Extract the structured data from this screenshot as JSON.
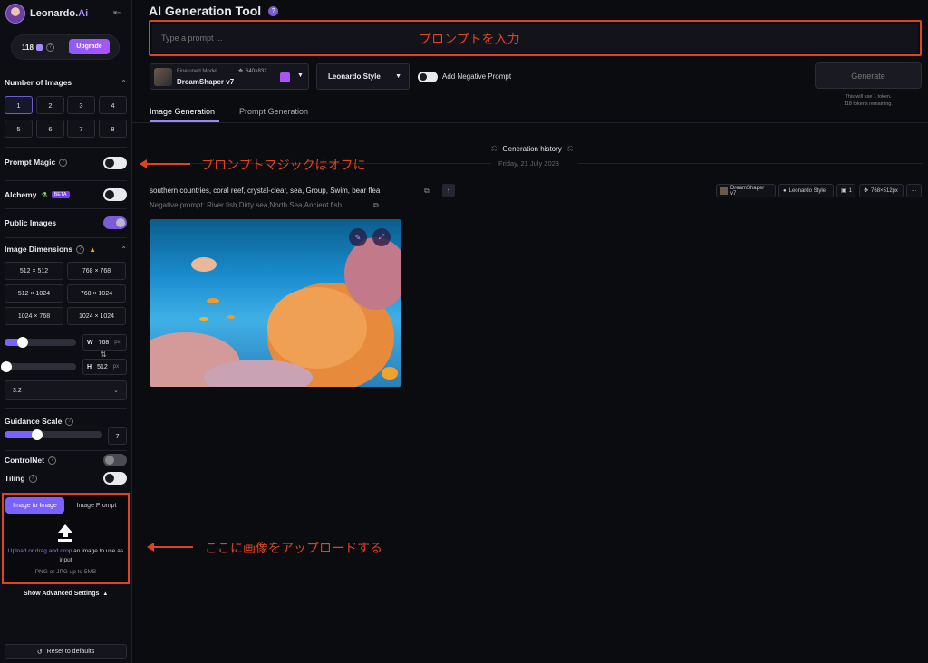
{
  "sidebar": {
    "brand": "Leonardo.",
    "brand_ai": "Ai",
    "tokens": "118",
    "upgrade": "Upgrade",
    "num_images_label": "Number of Images",
    "num_options": [
      "1",
      "2",
      "3",
      "4",
      "5",
      "6",
      "7",
      "8"
    ],
    "prompt_magic": "Prompt Magic",
    "alchemy": "Alchemy",
    "beta": "BETA",
    "public_images": "Public Images",
    "image_dimensions": "Image Dimensions",
    "dims": [
      "512 × 512",
      "768 × 768",
      "512 × 1024",
      "768 × 1024",
      "1024 × 768",
      "1024 × 1024"
    ],
    "w_label": "W",
    "w_value": "768",
    "h_label": "H",
    "h_value": "512",
    "px": "px",
    "ratio": "3:2",
    "guidance_label": "Guidance Scale",
    "guidance_value": "7",
    "controlnet": "ControlNet",
    "tiling": "Tiling",
    "tab_image_to_image": "Image to Image",
    "tab_image_prompt": "Image Prompt",
    "upload_link": "Upload or drag and drop",
    "upload_text": " an image to use as input",
    "upload_hint": "PNG or JPG up to 5MB",
    "advanced": "Show Advanced Settings",
    "reset": "Reset to defaults"
  },
  "main": {
    "title": "AI Generation Tool",
    "prompt_placeholder": "Type a prompt ...",
    "model_caption": "Finetuned Model",
    "model_size": "640×832",
    "model_name": "DreamShaper v7",
    "style": "Leonardo Style",
    "negative_toggle": "Add Negative Prompt",
    "generate": "Generate",
    "token_note1": "This will use 1 token.",
    "token_note2": "118 tokens remaining.",
    "tabs": [
      "Image Generation",
      "Prompt Generation"
    ],
    "history": "Generation history",
    "date": "Friday, 21 July 2023",
    "prompt_text": "southern countries, coral reef, crystal-clear, sea, Group, Swim, bear flea",
    "negative_text": "Negative prompt: River fish,Dirty sea,North Sea,Ancient fish",
    "chips": [
      "DreamShaper v7",
      "Leonardo Style",
      "1",
      "768×512px",
      "···"
    ]
  },
  "annotations": {
    "prompt": "プロンプトを入力",
    "magic": "プロンプトマジックはオフに",
    "upload": "ここに画像をアップロードする"
  },
  "colors": {
    "accent": "#7b61ff",
    "annotation": "#e0431f",
    "upgrade": "#8b5cf6"
  }
}
